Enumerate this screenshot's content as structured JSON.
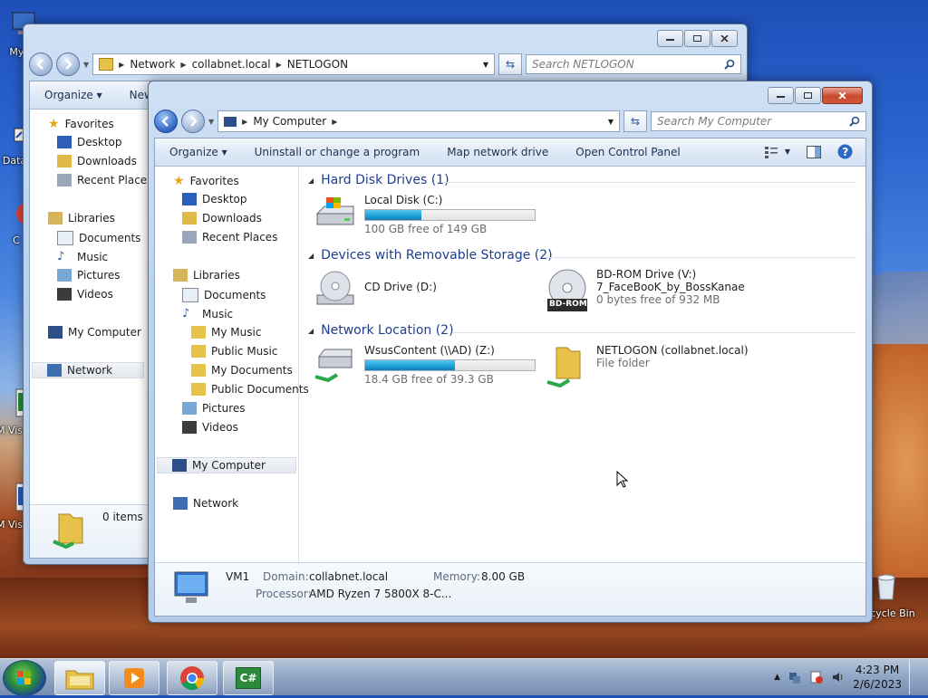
{
  "desktop": {
    "icons": [
      {
        "label": "My C"
      },
      {
        "label": "Data"
      },
      {
        "label": "C"
      },
      {
        "label": "M Visu"
      },
      {
        "label": "M Visu"
      },
      {
        "label": "Recycle Bin"
      }
    ]
  },
  "back_window": {
    "address": {
      "crumbs": [
        "Network",
        "collabnet.local",
        "NETLOGON"
      ]
    },
    "search_placeholder": "Search NETLOGON",
    "toolbar": {
      "organize": "Organize",
      "new": "New"
    },
    "nav": {
      "favorites": "Favorites",
      "favorite_items": [
        "Desktop",
        "Downloads",
        "Recent Places"
      ],
      "libraries": "Libraries",
      "library_items": [
        "Documents",
        "Music",
        "Pictures",
        "Videos"
      ],
      "my_computer": "My Computer",
      "network": "Network"
    },
    "status": "0 items"
  },
  "front_window": {
    "address": {
      "crumbs": [
        "My Computer"
      ]
    },
    "search_placeholder": "Search My Computer",
    "toolbar": {
      "organize": "Organize",
      "uninstall": "Uninstall or change a program",
      "map_drive": "Map network drive",
      "control_panel": "Open Control Panel"
    },
    "nav": {
      "favorites": "Favorites",
      "favorite_items": [
        "Desktop",
        "Downloads",
        "Recent Places"
      ],
      "libraries": "Libraries",
      "documents": "Documents",
      "music": "Music",
      "music_items": [
        "My Music",
        "Public Music",
        "My Documents",
        "Public Documents"
      ],
      "pictures": "Pictures",
      "videos": "Videos",
      "my_computer": "My Computer",
      "network": "Network"
    },
    "groups": {
      "hdd": "Hard Disk Drives (1)",
      "removable": "Devices with Removable Storage (2)",
      "network": "Network Location (2)"
    },
    "drives": {
      "c": {
        "name": "Local Disk (C:)",
        "free": "100 GB free of 149 GB",
        "used_fraction": 0.33
      },
      "d": {
        "name": "CD Drive (D:)"
      },
      "v": {
        "name": "BD-ROM Drive (V:)",
        "label": "7_FaceBooK_by_BossKanae",
        "free": "0 bytes free of 932 MB",
        "badge": "BD-ROM"
      },
      "z": {
        "name": "WsusContent (\\\\AD) (Z:)",
        "free": "18.4 GB free of 39.3 GB",
        "used_fraction": 0.53
      },
      "netlogon": {
        "name": "NETLOGON (collabnet.local)",
        "type": "File folder"
      }
    },
    "details": {
      "computer_name": "VM1",
      "domain_label": "Domain:",
      "domain": "collabnet.local",
      "memory_label": "Memory:",
      "memory": "8.00 GB",
      "processor_label": "Processor:",
      "processor": "AMD Ryzen 7 5800X 8-C..."
    }
  },
  "taskbar": {
    "apps": [
      "explorer-icon",
      "media-player-icon",
      "chrome-icon",
      "csharp-icon"
    ],
    "csharp_text": "C#",
    "clock_time": "4:23 PM",
    "clock_date": "2/6/2023"
  }
}
